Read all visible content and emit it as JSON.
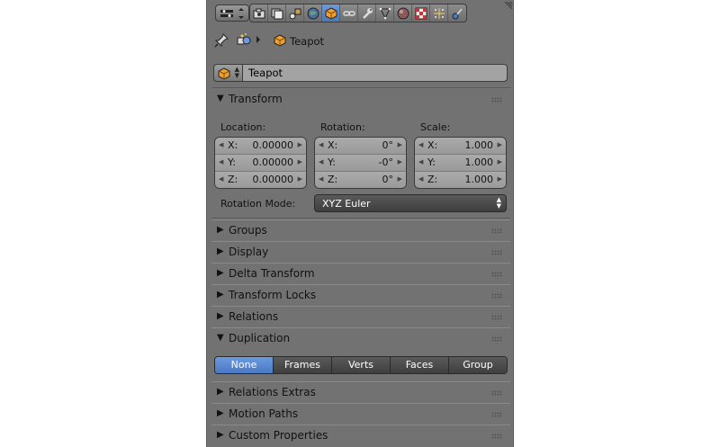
{
  "breadcrumb": {
    "object": "Teapot"
  },
  "name_field": {
    "value": "Teapot"
  },
  "transform": {
    "title": "Transform",
    "location_label": "Location:",
    "rotation_label": "Rotation:",
    "scale_label": "Scale:",
    "location": [
      {
        "axis": "X:",
        "value": "0.00000"
      },
      {
        "axis": "Y:",
        "value": "0.00000"
      },
      {
        "axis": "Z:",
        "value": "0.00000"
      }
    ],
    "rotation": [
      {
        "axis": "X:",
        "value": "0°"
      },
      {
        "axis": "Y:",
        "value": "-0°"
      },
      {
        "axis": "Z:",
        "value": "0°"
      }
    ],
    "scale": [
      {
        "axis": "X:",
        "value": "1.000"
      },
      {
        "axis": "Y:",
        "value": "1.000"
      },
      {
        "axis": "Z:",
        "value": "1.000"
      }
    ],
    "rotation_mode_label": "Rotation Mode:",
    "rotation_mode_value": "XYZ Euler"
  },
  "panels": {
    "groups": "Groups",
    "display": "Display",
    "delta_transform": "Delta Transform",
    "transform_locks": "Transform Locks",
    "relations": "Relations",
    "duplication": "Duplication",
    "relations_extras": "Relations Extras",
    "motion_paths": "Motion Paths",
    "custom_properties": "Custom Properties"
  },
  "duplication": {
    "options": [
      "None",
      "Frames",
      "Verts",
      "Faces",
      "Group"
    ],
    "selected": "None"
  },
  "colors": {
    "panel_bg": "#727272",
    "active_blue": "#5a89cc",
    "object_orange": "#e8a030"
  }
}
